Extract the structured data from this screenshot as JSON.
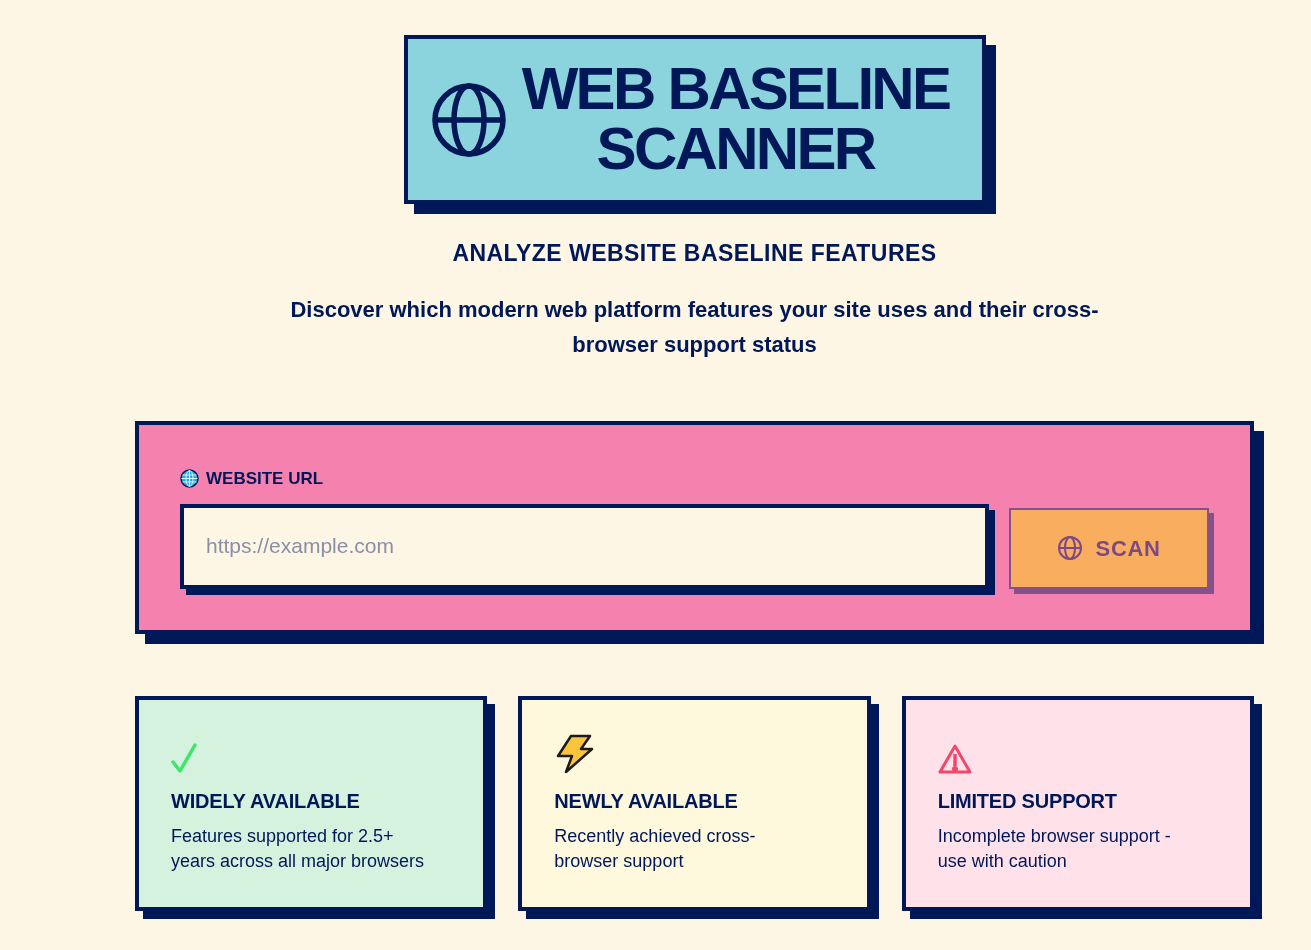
{
  "header": {
    "title": "WEB BASELINE SCANNER",
    "tagline": "ANALYZE WEBSITE BASELINE FEATURES",
    "description": "Discover which modern web platform features your site uses and their cross-browser support status"
  },
  "form": {
    "label": "WEBSITE URL",
    "url_field": {
      "placeholder": "https://example.com"
    },
    "scan_button": {
      "label": "SCAN",
      "disabled": true
    }
  },
  "legend": [
    {
      "kind": "widely",
      "title": "WIDELY AVAILABLE",
      "description": "Features supported for 2.5+ years across all major browsers"
    },
    {
      "kind": "newly",
      "title": "NEWLY AVAILABLE",
      "description": "Recently achieved cross-browser support"
    },
    {
      "kind": "limited",
      "title": "LIMITED SUPPORT",
      "description": "Incomplete browser support - use with caution"
    }
  ]
}
